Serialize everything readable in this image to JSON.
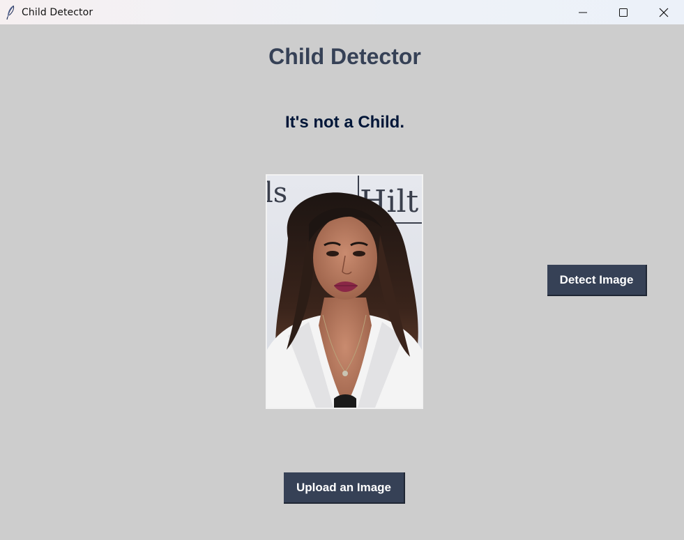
{
  "window": {
    "title": "Child Detector",
    "controls": [
      "minimize-icon",
      "maximize-icon",
      "close-icon"
    ]
  },
  "main": {
    "heading": "Child Detector",
    "result": "It's not a Child.",
    "photo": {
      "sign_text_left": "ls",
      "sign_text_right": "Hilt"
    },
    "detect_button": "Detect Image",
    "upload_button": "Upload an Image"
  },
  "colors": {
    "background": "#cdcdcd",
    "heading": "#364156",
    "result": "#011638",
    "button_bg": "#364156",
    "button_text": "#ffffff"
  }
}
